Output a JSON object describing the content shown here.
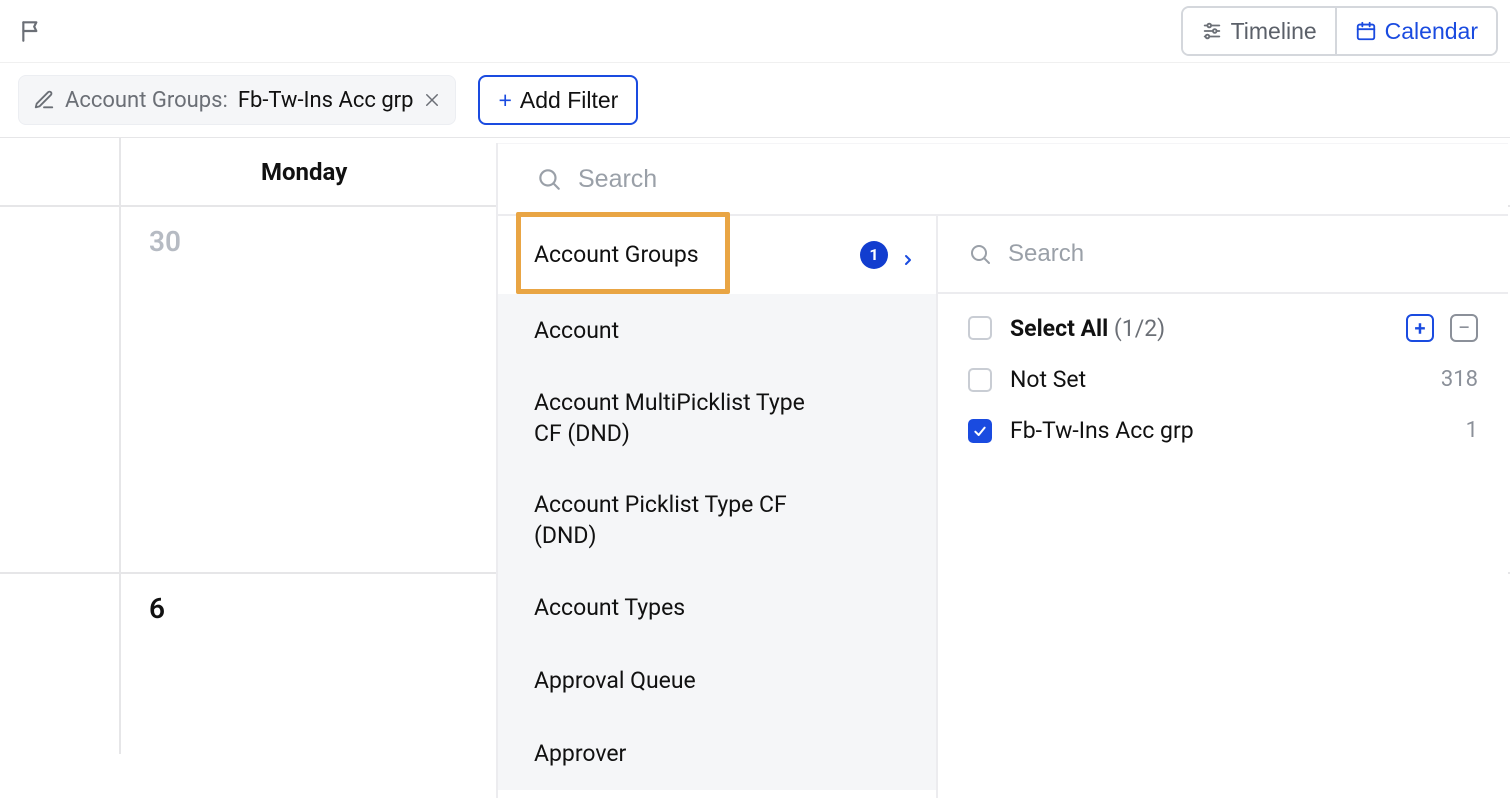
{
  "header": {
    "view_timeline": "Timeline",
    "view_calendar": "Calendar"
  },
  "filters": {
    "chip_label": "Account Groups:",
    "chip_value": "Fb-Tw-Ins Acc grp",
    "add_filter": "Add Filter"
  },
  "calendar": {
    "day_label": "Monday",
    "dates": {
      "prev": "30",
      "cur": "6"
    }
  },
  "panel": {
    "search_placeholder": "Search",
    "categories": [
      "Account Groups",
      "Account",
      "Account MultiPicklist Type CF (DND)",
      "Account Picklist Type CF (DND)",
      "Account Types",
      "Approval Queue",
      "Approver"
    ],
    "selected_category_badge": "1",
    "values_search_placeholder": "Search",
    "select_all_label": "Select All",
    "select_all_count": "(1/2)",
    "options": [
      {
        "label": "Not Set",
        "count": "318",
        "checked": false
      },
      {
        "label": "Fb-Tw-Ins Acc grp",
        "count": "1",
        "checked": true
      }
    ]
  }
}
